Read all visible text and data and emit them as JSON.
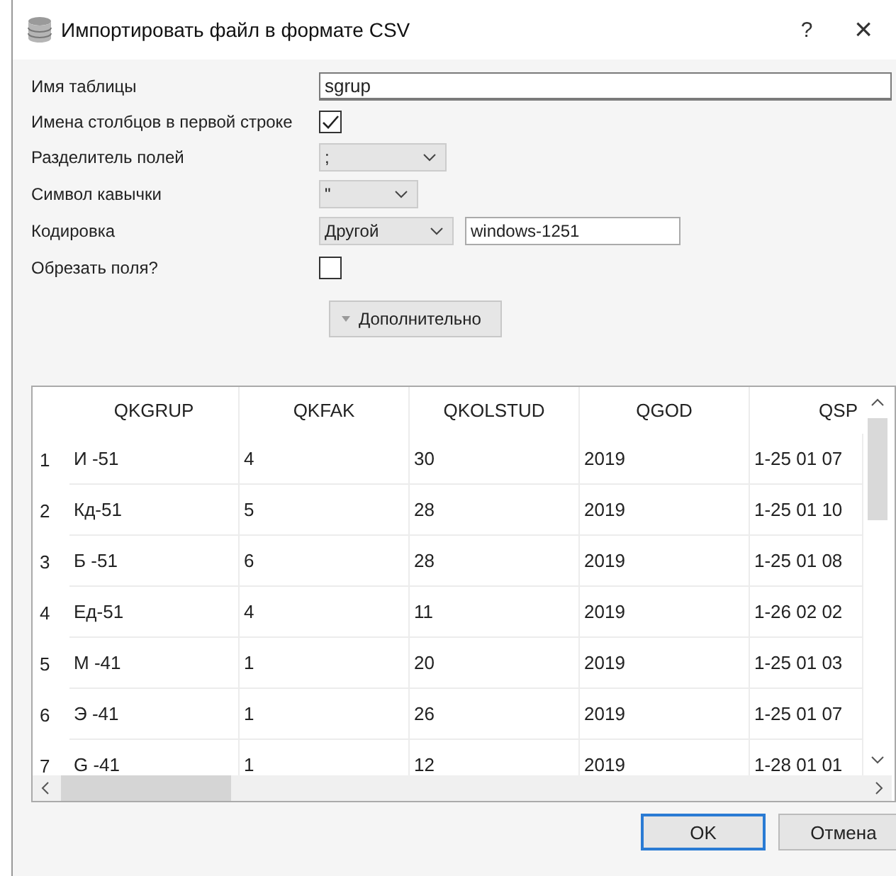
{
  "window": {
    "title": "Импортировать файл в формате CSV",
    "help": "?",
    "close": "×"
  },
  "form": [
    {
      "kind": "text",
      "label": "Имя таблицы",
      "value": "sgrup"
    },
    {
      "kind": "checkbox",
      "label": "Имена столбцов в первой строке",
      "checked": true
    },
    {
      "kind": "select",
      "label": "Разделитель полей",
      "value": ";"
    },
    {
      "kind": "select",
      "label": "Символ кавычки",
      "value": "\""
    },
    {
      "kind": "select-text",
      "label": "Кодировка",
      "value": "Другой",
      "text": "windows-1251"
    },
    {
      "kind": "checkbox",
      "label": "Обрезать поля?",
      "checked": false
    }
  ],
  "advanced_button": "Дополнительно",
  "table": {
    "columns": [
      "QKGRUP",
      "QKFAK",
      "QKOLSTUD",
      "QGOD",
      "QSP"
    ],
    "rows": [
      {
        "number": "1",
        "cells": [
          "И -51",
          "4",
          "30",
          "2019",
          "1-25 01 07"
        ]
      },
      {
        "number": "2",
        "cells": [
          "Кд-51",
          "5",
          "28",
          "2019",
          "1-25 01 10"
        ]
      },
      {
        "number": "3",
        "cells": [
          "Б -51",
          "6",
          "28",
          "2019",
          "1-25 01 08"
        ]
      },
      {
        "number": "4",
        "cells": [
          "Ед-51",
          "4",
          "11",
          "2019",
          "1-26 02 02"
        ]
      },
      {
        "number": "5",
        "cells": [
          "М -41",
          "1",
          "20",
          "2019",
          "1-25 01 03"
        ]
      },
      {
        "number": "6",
        "cells": [
          "Э -41",
          "1",
          "26",
          "2019",
          "1-25 01 07"
        ]
      },
      {
        "number": "7",
        "cells": [
          "G -41",
          "1",
          "12",
          "2019",
          "1-28 01 01"
        ]
      }
    ]
  },
  "buttons": [
    {
      "label": "OK",
      "default": true
    },
    {
      "label": "Отмена",
      "default": false
    }
  ]
}
